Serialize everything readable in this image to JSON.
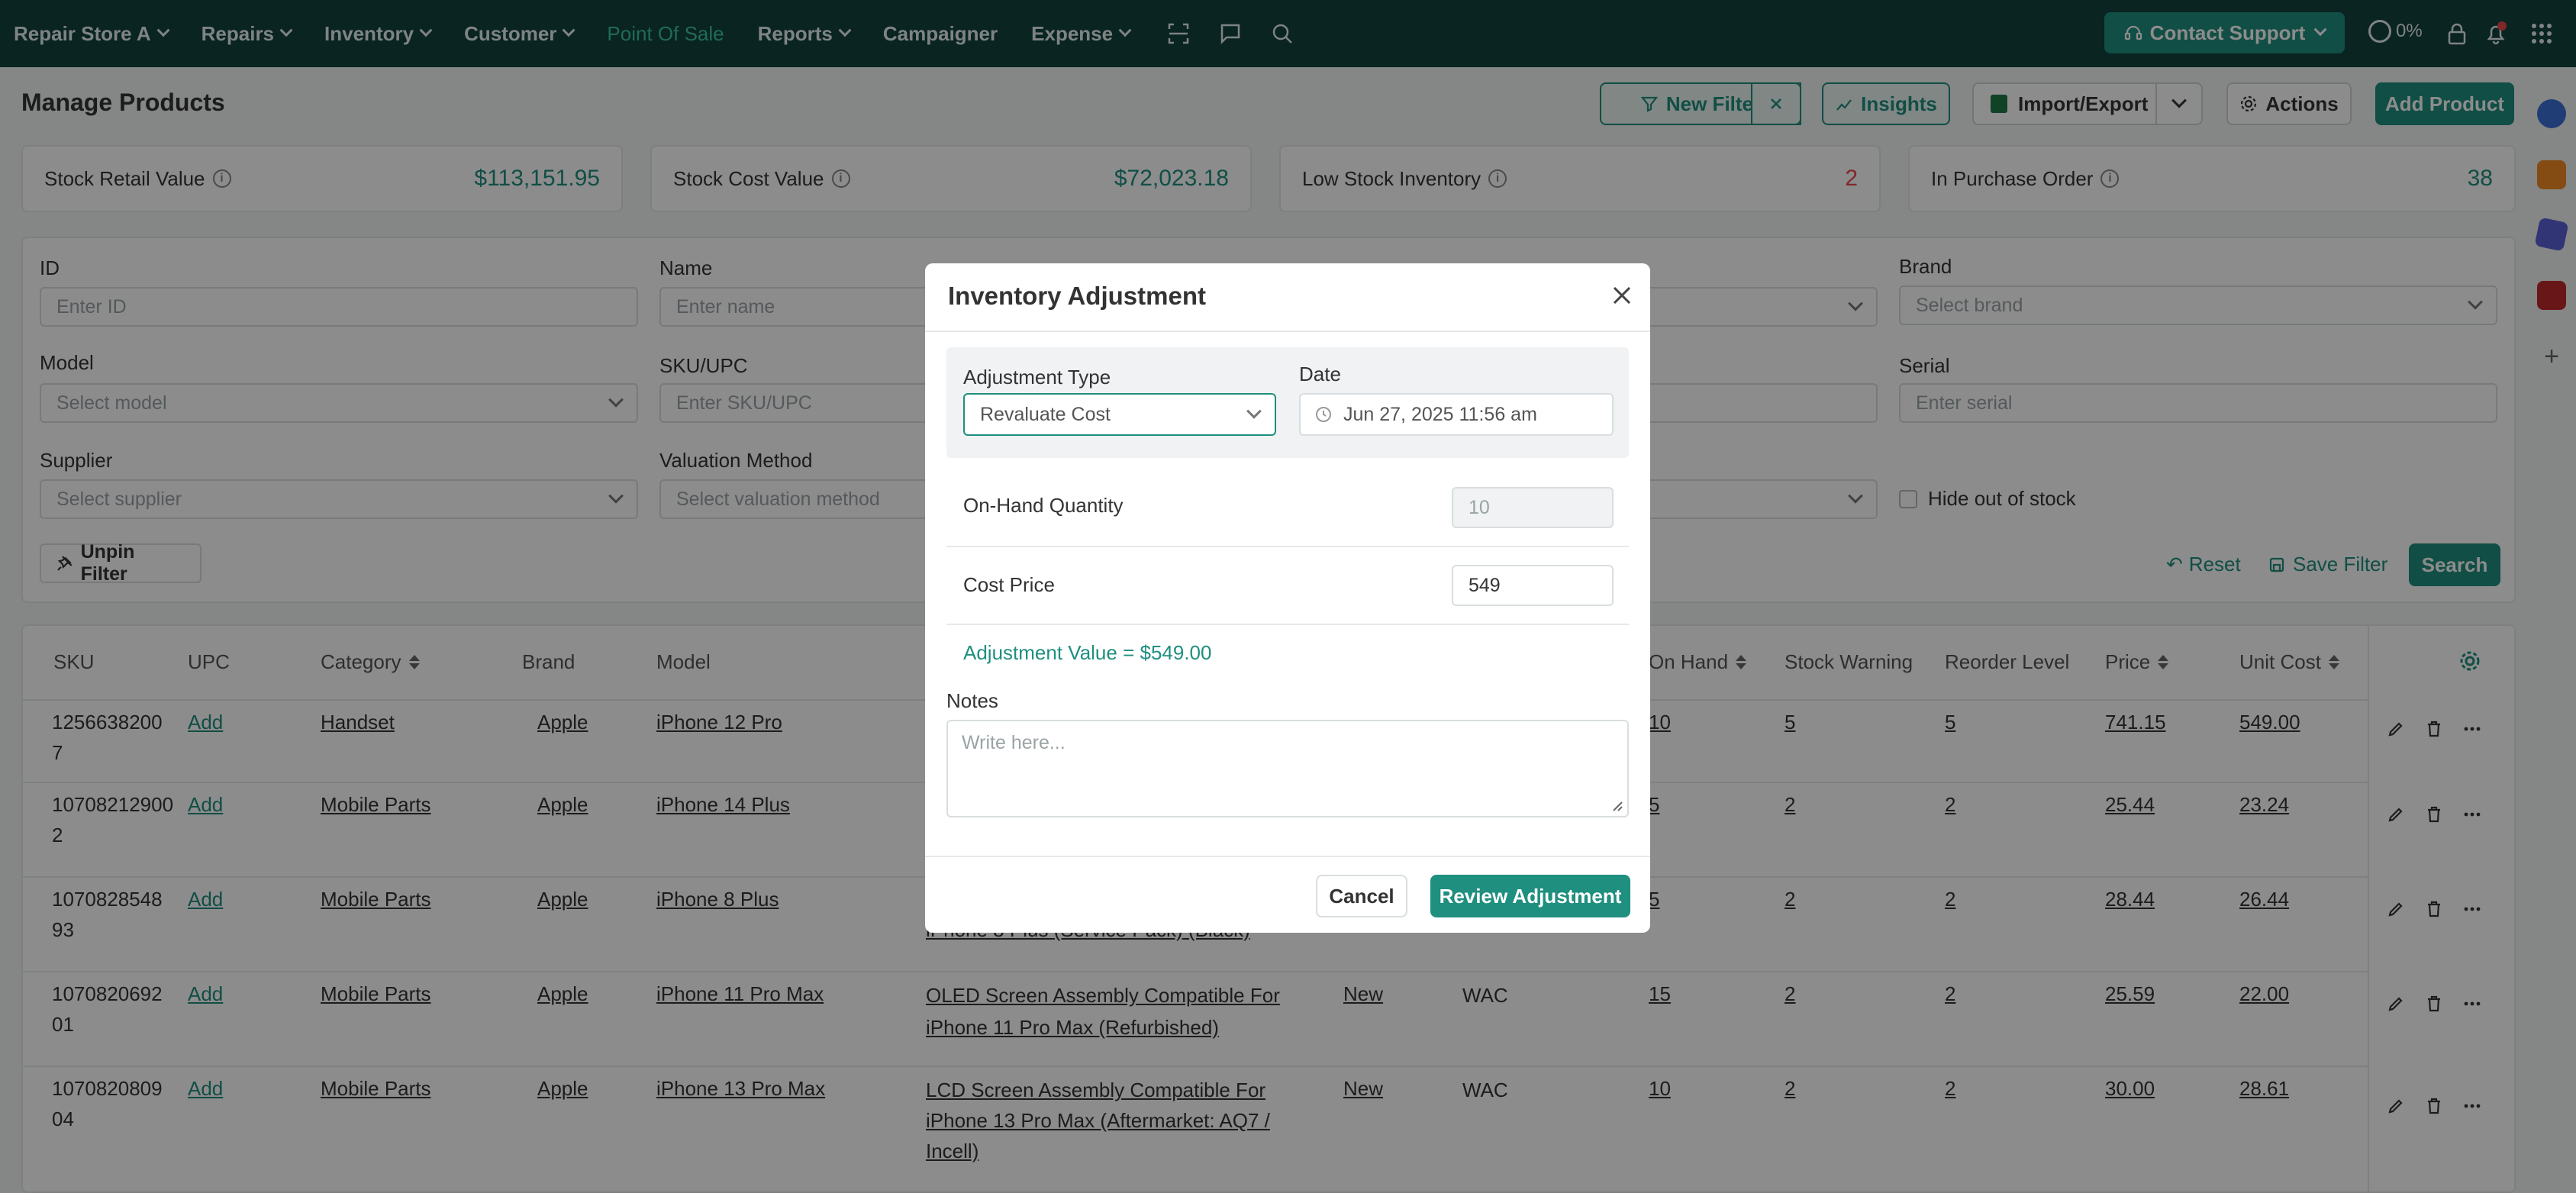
{
  "nav": {
    "store": "Repair Store A",
    "items": [
      "Repairs",
      "Inventory",
      "Customer"
    ],
    "point_of_sale": "Point Of Sale",
    "reports": "Reports",
    "campaigner": "Campaigner",
    "expense": "Expense",
    "contact_support": "Contact Support",
    "progress": "0%"
  },
  "page": {
    "title": "Manage Products",
    "buttons": {
      "new_filter": "New Filter",
      "insights": "Insights",
      "import_export": "Import/Export",
      "actions": "Actions",
      "add_product": "Add Product"
    }
  },
  "stats": [
    {
      "label": "Stock Retail Value",
      "value": "$113,151.95"
    },
    {
      "label": "Stock Cost Value",
      "value": "$72,023.18"
    },
    {
      "label": "Low Stock Inventory",
      "value": "2"
    },
    {
      "label": "In Purchase Order",
      "value": "38"
    }
  ],
  "filters": {
    "id_label": "ID",
    "id_placeholder": "Enter ID",
    "name_label": "Name",
    "name_placeholder": "Enter name",
    "brand_label": "Brand",
    "brand_placeholder": "Select brand",
    "model_label": "Model",
    "model_placeholder": "Select model",
    "sku_label": "SKU/UPC",
    "sku_placeholder": "Enter SKU/UPC",
    "serial_label": "Serial",
    "serial_placeholder": "Enter serial",
    "supplier_label": "Supplier",
    "supplier_placeholder": "Select supplier",
    "valuation_label": "Valuation Method",
    "valuation_placeholder": "Select valuation method",
    "hide_out_of_stock": "Hide out of stock",
    "unpin_filter": "Unpin Filter",
    "reset": "Reset",
    "save_filter": "Save Filter",
    "search": "Search"
  },
  "table": {
    "headers": {
      "sku": "SKU",
      "upc": "UPC",
      "category": "Category",
      "brand": "Brand",
      "model": "Model",
      "on_hand": "On Hand",
      "stock_warning": "Stock Warning",
      "reorder_level": "Reorder Level",
      "price": "Price",
      "unit_cost": "Unit Cost"
    },
    "rows": [
      {
        "sku1": "1256638200",
        "sku2": "7",
        "upc": "Add",
        "category": "Handset",
        "brand": "Apple",
        "model": "iPhone 12 Pro",
        "name1": "",
        "name2": "",
        "name3": "",
        "condition": "",
        "valuation": "",
        "on_hand": "10",
        "stock_warning": "5",
        "reorder_level": "5",
        "price": "741.15",
        "unit_cost": "549.00"
      },
      {
        "sku1": "10708212900",
        "sku2": "2",
        "upc": "Add",
        "category": "Mobile Parts",
        "brand": "Apple",
        "model": "iPhone 14 Plus",
        "name1": "",
        "name2": "",
        "name3": "",
        "condition": "",
        "valuation": "",
        "on_hand": "5",
        "stock_warning": "2",
        "reorder_level": "2",
        "price": "25.44",
        "unit_cost": "23.24"
      },
      {
        "sku1": "1070828548",
        "sku2": "93",
        "upc": "Add",
        "category": "Mobile Parts",
        "brand": "Apple",
        "model": "iPhone 8 Plus",
        "name1": "",
        "name2": "iPhone 8 Plus (Service Pack) (Black)",
        "name3": "",
        "condition": "",
        "valuation": "",
        "on_hand": "5",
        "stock_warning": "2",
        "reorder_level": "2",
        "price": "28.44",
        "unit_cost": "26.44"
      },
      {
        "sku1": "1070820692",
        "sku2": "01",
        "upc": "Add",
        "category": "Mobile Parts",
        "brand": "Apple",
        "model": "iPhone 11 Pro Max",
        "name1": "OLED Screen Assembly Compatible For",
        "name2": "iPhone 11 Pro Max (Refurbished)",
        "name3": "",
        "condition": "New",
        "valuation": "WAC",
        "on_hand": "15",
        "stock_warning": "2",
        "reorder_level": "2",
        "price": "25.59",
        "unit_cost": "22.00"
      },
      {
        "sku1": "1070820809",
        "sku2": "04",
        "upc": "Add",
        "category": "Mobile Parts",
        "brand": "Apple",
        "model": "iPhone 13 Pro Max",
        "name1": "LCD Screen Assembly Compatible For",
        "name2": "iPhone 13 Pro Max (Aftermarket: AQ7 /",
        "name3": "Incell)",
        "condition": "New",
        "valuation": "WAC",
        "on_hand": "10",
        "stock_warning": "2",
        "reorder_level": "2",
        "price": "30.00",
        "unit_cost": "28.61"
      }
    ]
  },
  "modal": {
    "title": "Inventory Adjustment",
    "adjustment_type_label": "Adjustment Type",
    "adjustment_type_value": "Revaluate Cost",
    "date_label": "Date",
    "date_value": "Jun 27, 2025 11:56 am",
    "on_hand_label": "On-Hand Quantity",
    "on_hand_value": "10",
    "cost_price_label": "Cost Price",
    "cost_price_value": "549",
    "adjustment_value": "Adjustment Value = $549.00",
    "notes_label": "Notes",
    "notes_placeholder": "Write here...",
    "cancel": "Cancel",
    "review": "Review Adjustment"
  },
  "colors": {
    "topbar": "#12433d",
    "accent": "#1f8f7f",
    "danger": "#e84a4a"
  }
}
